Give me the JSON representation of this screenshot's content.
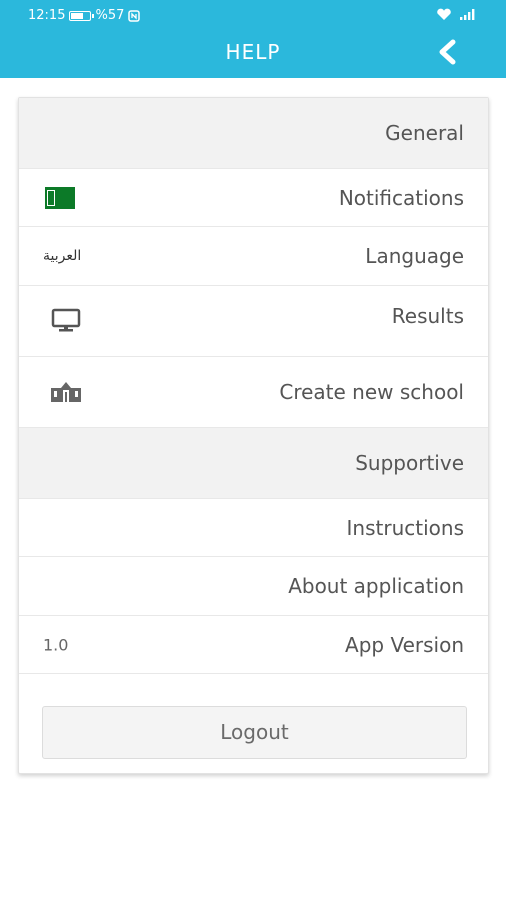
{
  "status_bar": {
    "time": "12:15",
    "battery": "%57",
    "battery_level": 0.57
  },
  "header": {
    "title": "HELP"
  },
  "menu": {
    "general": "General",
    "notifications": "Notifications",
    "language": "Language",
    "language_value": "العربية",
    "results": "Results",
    "create_school": "Create new school",
    "supportive": "Supportive",
    "instructions": "Instructions",
    "about": "About application",
    "app_version": "App Version",
    "app_version_value": "1.0"
  },
  "logout_label": "Logout",
  "colors": {
    "accent": "#2bb8dc",
    "section_bg": "#f2f2f2",
    "notification_toggle": "#0c7a28"
  },
  "icons": {
    "back": "chevron-left-icon",
    "results": "monitor-icon",
    "school": "school-building-icon",
    "notifications": "toggle-icon"
  }
}
